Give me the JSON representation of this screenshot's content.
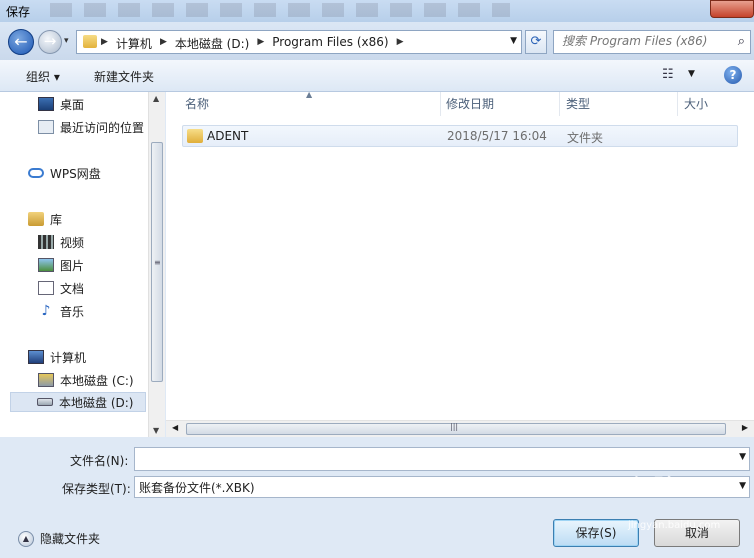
{
  "window": {
    "title": "保存"
  },
  "address_bar": {
    "crumbs": [
      "计算机",
      "本地磁盘 (D:)",
      "Program Files (x86)"
    ]
  },
  "search": {
    "placeholder": "搜索 Program Files (x86)",
    "icon": "search-icon"
  },
  "toolbar": {
    "organize_label": "组织 ▾",
    "new_folder_label": "新建文件夹",
    "help_label": "?"
  },
  "nav": {
    "items": [
      {
        "label": "桌面",
        "icon": "desktop-icon"
      },
      {
        "label": "最近访问的位置",
        "icon": "recent-places-icon"
      },
      {
        "label": "WPS网盘",
        "icon": "cloud-icon"
      },
      {
        "label": "库",
        "icon": "library-icon"
      },
      {
        "label": "视频",
        "icon": "video-icon"
      },
      {
        "label": "图片",
        "icon": "picture-icon"
      },
      {
        "label": "文档",
        "icon": "document-icon"
      },
      {
        "label": "音乐",
        "icon": "music-icon"
      },
      {
        "label": "计算机",
        "icon": "computer-icon"
      },
      {
        "label": "本地磁盘 (C:)",
        "icon": "drive-c-icon"
      },
      {
        "label": "本地磁盘 (D:)",
        "icon": "drive-d-icon",
        "selected": true
      }
    ]
  },
  "file_list": {
    "columns": [
      "名称",
      "修改日期",
      "类型",
      "大小"
    ],
    "rows": [
      {
        "name": "ADENT",
        "modified": "2018/5/17 16:04",
        "type": "文件夹",
        "size": ""
      }
    ]
  },
  "form": {
    "filename_label": "文件名(N):",
    "filename_value": "",
    "filetype_label": "保存类型(T):",
    "filetype_value": "账套备份文件(*.XBK)",
    "hide_folders_label": "隐藏文件夹",
    "save_label": "保存(S)",
    "cancel_label": "取消"
  },
  "watermark": {
    "text": "Bai 经验",
    "sub": "jingyan.baidu.com"
  }
}
